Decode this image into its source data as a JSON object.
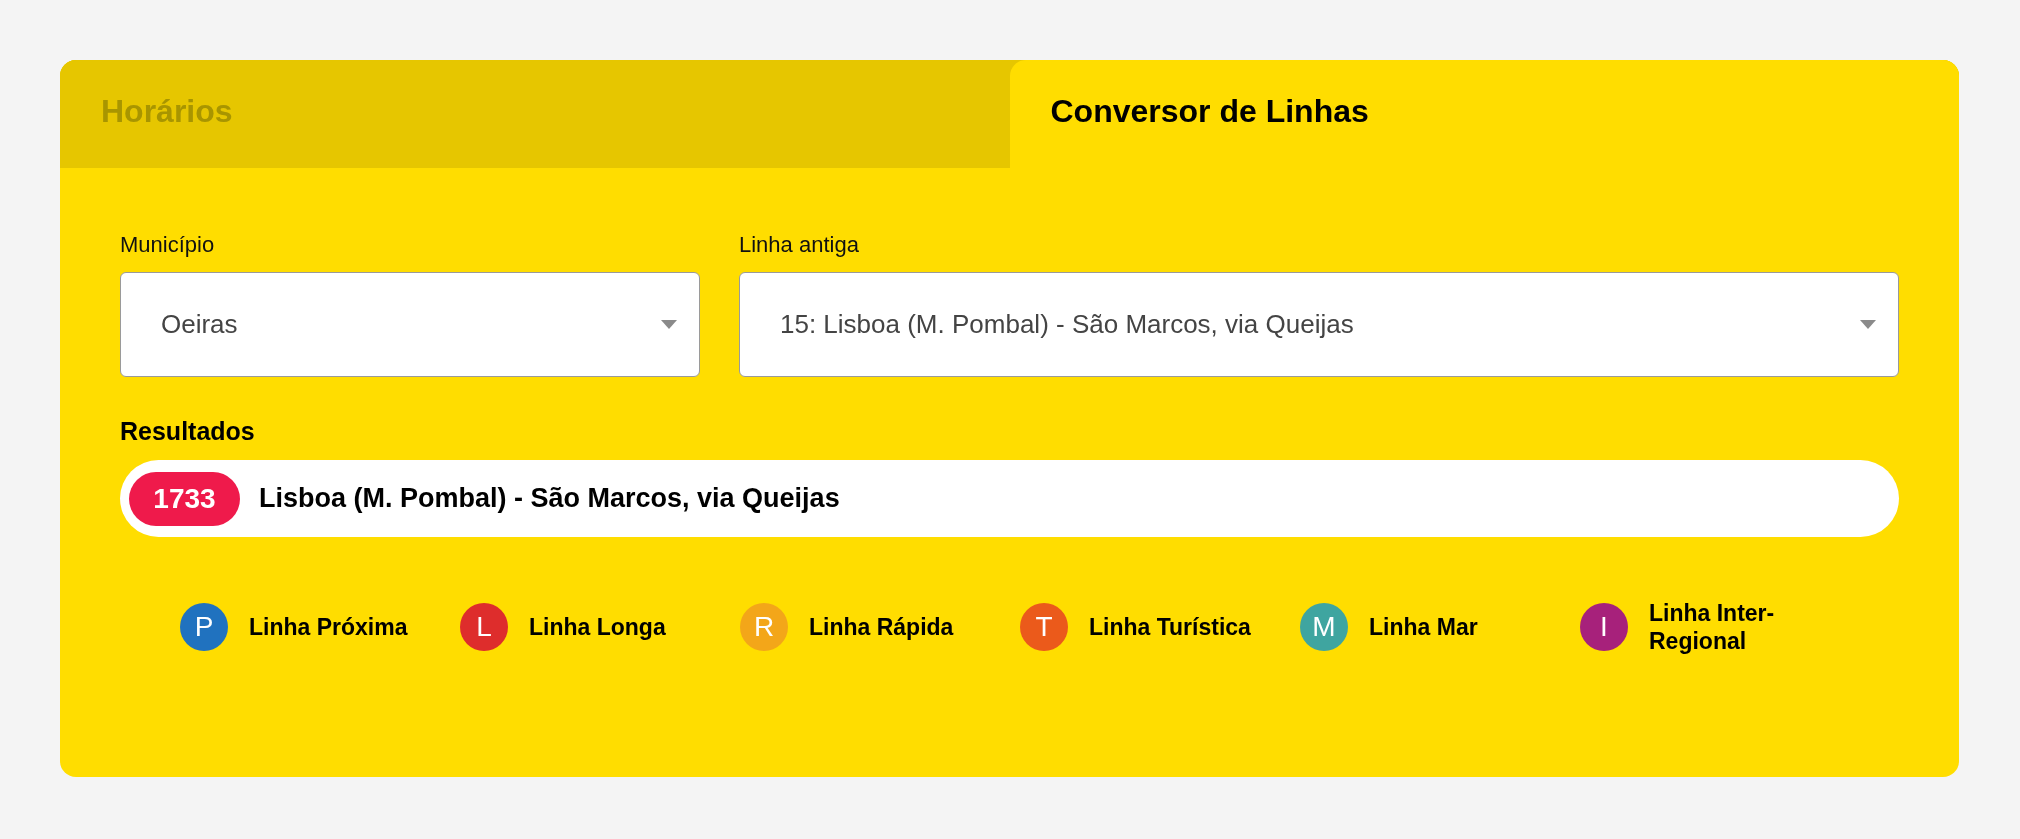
{
  "tabs": [
    {
      "label": "Horários",
      "selected": false
    },
    {
      "label": "Conversor de Linhas",
      "selected": true
    }
  ],
  "fields": [
    {
      "label": "Município",
      "value": "Oeiras"
    },
    {
      "label": "Linha antiga",
      "value": "15: Lisboa (M. Pombal) - São Marcos, via Queijas"
    }
  ],
  "results": {
    "title": "Resultados",
    "items": [
      {
        "number": "1733",
        "name": "Lisboa (M. Pombal) - São Marcos, via Queijas",
        "color": "#ef1a4b"
      }
    ]
  },
  "legend": [
    {
      "letter": "P",
      "label": "Linha Próxima",
      "color": "#2072bf"
    },
    {
      "letter": "L",
      "label": "Linha Longa",
      "color": "#de2d2c"
    },
    {
      "letter": "R",
      "label": "Linha Rápida",
      "color": "#f3a619"
    },
    {
      "letter": "T",
      "label": "Linha Turística",
      "color": "#eb5a1b"
    },
    {
      "letter": "M",
      "label": "Linha Mar",
      "color": "#3fa5a0"
    },
    {
      "letter": "I",
      "label": "Linha Inter-Regional",
      "color": "#a7217b"
    }
  ]
}
